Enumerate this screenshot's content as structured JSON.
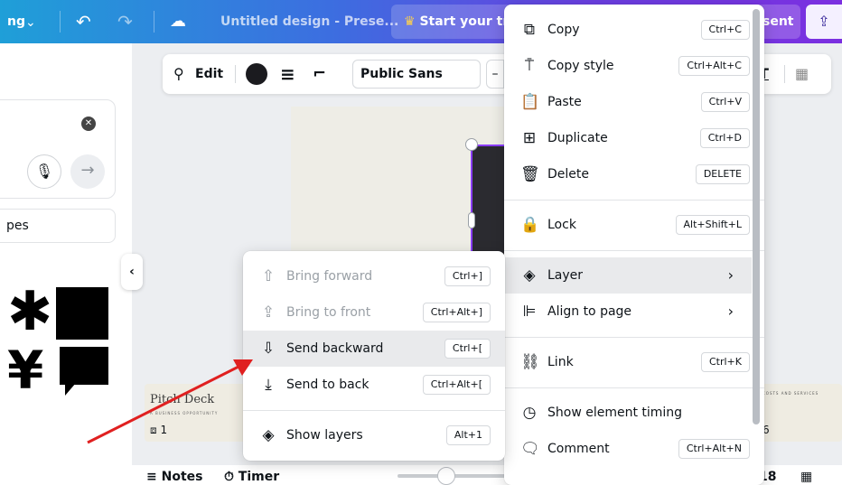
{
  "topbar": {
    "left_text": "ng",
    "design_title": "Untitled design - Prese...",
    "trial_label": "Start your trial",
    "present_label": "sent"
  },
  "left_panel": {
    "chip_text": "pes"
  },
  "toolbar": {
    "edit_label": "Edit",
    "font_name": "Public Sans",
    "size_prefix": "–"
  },
  "thumbnails": {
    "first_title": "Pitch Deck",
    "first_subtitle": "A BUSINESS OPPORTUNITY",
    "first_number": "1",
    "last_title": "COSTS AND SERVICES",
    "last_number": "6"
  },
  "bottom": {
    "notes_label": "Notes",
    "timer_label": "Timer",
    "page_count": "18"
  },
  "main_menu": {
    "items": [
      {
        "label": "Copy",
        "shortcut": "Ctrl+C",
        "icon": "copy-icon"
      },
      {
        "label": "Copy style",
        "shortcut": "Ctrl+Alt+C",
        "icon": "paint-roller-icon"
      },
      {
        "label": "Paste",
        "shortcut": "Ctrl+V",
        "icon": "clipboard-icon"
      },
      {
        "label": "Duplicate",
        "shortcut": "Ctrl+D",
        "icon": "duplicate-icon"
      },
      {
        "label": "Delete",
        "shortcut": "DELETE",
        "icon": "trash-icon"
      },
      {
        "label": "Lock",
        "shortcut": "Alt+Shift+L",
        "icon": "lock-icon"
      },
      {
        "label": "Layer",
        "shortcut": "",
        "icon": "layers-icon"
      },
      {
        "label": "Align to page",
        "shortcut": "",
        "icon": "align-icon"
      },
      {
        "label": "Link",
        "shortcut": "Ctrl+K",
        "icon": "link-icon"
      },
      {
        "label": "Show element timing",
        "shortcut": "",
        "icon": "clock-icon"
      },
      {
        "label": "Comment",
        "shortcut": "Ctrl+Alt+N",
        "icon": "comment-icon"
      }
    ]
  },
  "layer_menu": {
    "items": [
      {
        "label": "Bring forward",
        "shortcut": "Ctrl+]",
        "icon": "bring-forward-icon",
        "disabled": true
      },
      {
        "label": "Bring to front",
        "shortcut": "Ctrl+Alt+]",
        "icon": "bring-to-front-icon",
        "disabled": true
      },
      {
        "label": "Send backward",
        "shortcut": "Ctrl+[",
        "icon": "send-backward-icon",
        "disabled": false
      },
      {
        "label": "Send to back",
        "shortcut": "Ctrl+Alt+[",
        "icon": "send-to-back-icon",
        "disabled": false
      },
      {
        "label": "Show layers",
        "shortcut": "Alt+1",
        "icon": "layers-icon",
        "disabled": false
      }
    ]
  },
  "colors": {
    "accent": "#8b3dff",
    "annotation_arrow": "#e02020"
  }
}
